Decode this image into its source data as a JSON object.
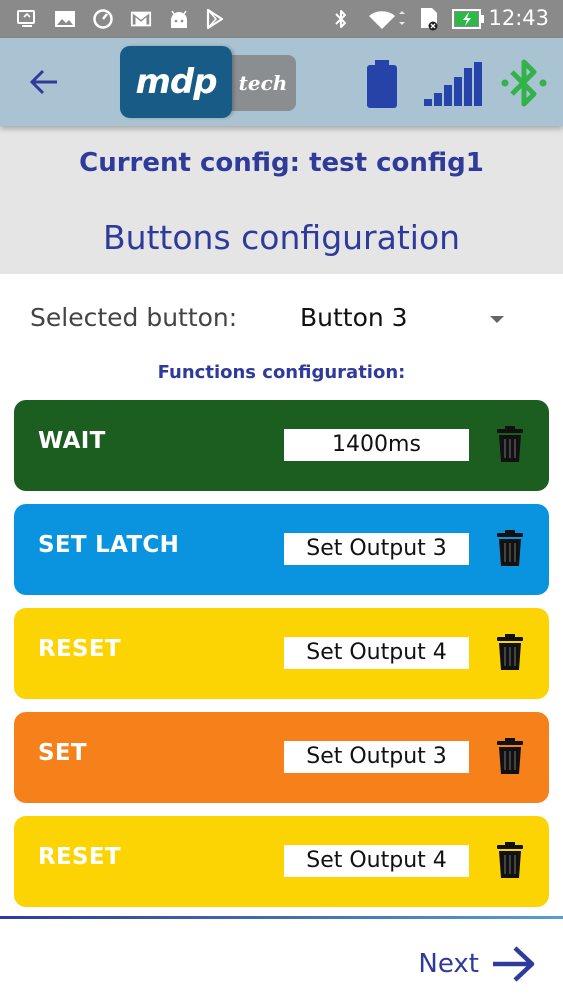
{
  "status_bar": {
    "time": "12:43",
    "icons": [
      "usb-icon",
      "gallery-icon",
      "data-saver-icon",
      "gmail-icon",
      "android-icon",
      "play-store-icon",
      "bluetooth-icon",
      "wifi-icon",
      "sim-icon",
      "battery-charging-icon"
    ]
  },
  "toolbar": {
    "logo_main": "mdp",
    "logo_sub": "tech",
    "colors": {
      "background": "#a9c3d3",
      "logo": "#175b86",
      "bluetooth": "#34b24a",
      "device_icons": "#2543a8"
    }
  },
  "header": {
    "current_config": "Current config: test config1",
    "title": "Buttons configuration"
  },
  "selection": {
    "label": "Selected button:",
    "value": "Button 3"
  },
  "functions_title": "Functions configuration:",
  "functions": [
    {
      "label": "WAIT",
      "value": "1400ms",
      "color": "#1c5e20",
      "label_color": "#ffffff"
    },
    {
      "label": "SET LATCH",
      "value": "Set Output 3",
      "color": "#0a94e0",
      "label_color": "#ffffff"
    },
    {
      "label": "RESET",
      "value": "Set Output 4",
      "color": "#fcd404",
      "label_color": "#ffffff"
    },
    {
      "label": "SET",
      "value": "Set Output 3",
      "color": "#f6811b",
      "label_color": "#ffffff"
    },
    {
      "label": "RESET",
      "value": "Set Output 4",
      "color": "#fcd404",
      "label_color": "#ffffff"
    }
  ],
  "footer": {
    "next_label": "Next"
  }
}
